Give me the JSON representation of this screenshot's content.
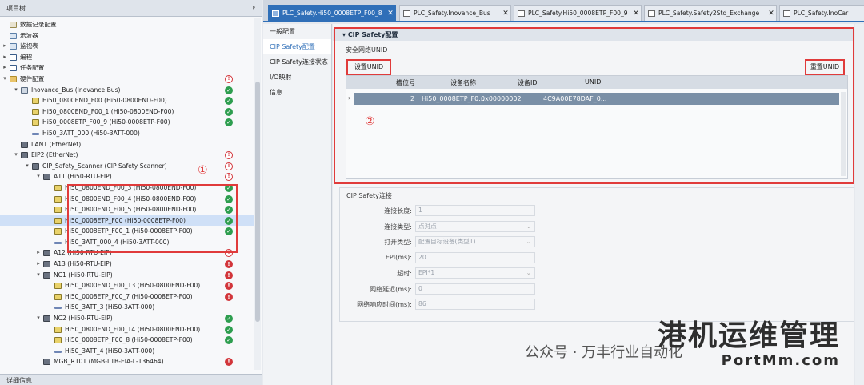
{
  "project_tree": {
    "title": "项目树",
    "pin": "ᵖ",
    "footer": "详细信息",
    "items": [
      {
        "label": "数据记录配置",
        "level": 3,
        "icon": "rec",
        "arrow": "",
        "status": ""
      },
      {
        "label": "示波器",
        "level": 3,
        "icon": "tab",
        "arrow": "",
        "status": ""
      },
      {
        "label": "监视表",
        "level": 3,
        "icon": "tab",
        "arrow": "▸",
        "status": ""
      },
      {
        "label": "编程",
        "level": 3,
        "icon": "doc",
        "arrow": "▸",
        "status": ""
      },
      {
        "label": "任务配置",
        "level": 3,
        "icon": "doc",
        "arrow": "▸",
        "status": ""
      },
      {
        "label": "硬件配置",
        "level": 3,
        "icon": "fold",
        "arrow": "▾",
        "status": "warn"
      },
      {
        "label": "Inovance_Bus (Inovance Bus)",
        "level": 4,
        "icon": "bus",
        "arrow": "▾",
        "status": "ok"
      },
      {
        "label": "Hi50_0800END_F00 (Hi50-0800END-F00)",
        "level": 5,
        "icon": "mod",
        "arrow": "",
        "status": "ok"
      },
      {
        "label": "Hi50_0800END_F00_1 (Hi50-0800END-F00)",
        "level": 5,
        "icon": "mod",
        "arrow": "",
        "status": "ok"
      },
      {
        "label": "Hi50_0008ETP_F00_9 (Hi50-0008ETP-F00)",
        "level": 5,
        "icon": "mod",
        "arrow": "",
        "status": "ok"
      },
      {
        "label": "Hi50_3ATT_000 (Hi50-3ATT-000)",
        "level": 5,
        "icon": "flat",
        "arrow": "",
        "status": ""
      },
      {
        "label": "LAN1 (EtherNet)",
        "level": 4,
        "icon": "dark",
        "arrow": "",
        "status": ""
      },
      {
        "label": "EIP2 (EtherNet)",
        "level": 4,
        "icon": "dark",
        "arrow": "▾",
        "status": "warn"
      },
      {
        "label": "CIP_Safety_Scanner (CIP Safety Scanner)",
        "level": 5,
        "icon": "dark",
        "arrow": "▾",
        "status": "warn"
      },
      {
        "label": "A11 (Hi50-RTU-EIP)",
        "level": 6,
        "icon": "dark",
        "arrow": "▾",
        "status": "warn"
      },
      {
        "label": "Hi50_0800END_F00_3 (Hi50-0800END-F00)",
        "level": 7,
        "icon": "mod",
        "arrow": "",
        "status": "ok"
      },
      {
        "label": "Hi50_0800END_F00_4 (Hi50-0800END-F00)",
        "level": 7,
        "icon": "mod",
        "arrow": "",
        "status": "ok"
      },
      {
        "label": "Hi50_0800END_F00_5 (Hi50-0800END-F00)",
        "level": 7,
        "icon": "mod",
        "arrow": "",
        "status": "ok"
      },
      {
        "label": "Hi50_0008ETP_F00 (Hi50-0008ETP-F00)",
        "level": 7,
        "icon": "mod",
        "arrow": "",
        "status": "ok",
        "selected": true
      },
      {
        "label": "Hi50_0008ETP_F00_1 (Hi50-0008ETP-F00)",
        "level": 7,
        "icon": "mod",
        "arrow": "",
        "status": "ok"
      },
      {
        "label": "Hi50_3ATT_000_4 (Hi50-3ATT-000)",
        "level": 7,
        "icon": "flat",
        "arrow": "",
        "status": ""
      },
      {
        "label": "A12 (Hi50-RTU-EIP)",
        "level": 6,
        "icon": "dark",
        "arrow": "▸",
        "status": "warn"
      },
      {
        "label": "A13 (Hi50-RTU-EIP)",
        "level": 6,
        "icon": "dark",
        "arrow": "▸",
        "status": "err"
      },
      {
        "label": "NC1 (Hi50-RTU-EIP)",
        "level": 6,
        "icon": "dark",
        "arrow": "▾",
        "status": "err"
      },
      {
        "label": "Hi50_0800END_F00_13 (Hi50-0800END-F00)",
        "level": 7,
        "icon": "mod",
        "arrow": "",
        "status": "err"
      },
      {
        "label": "Hi50_0008ETP_F00_7 (Hi50-0008ETP-F00)",
        "level": 7,
        "icon": "mod",
        "arrow": "",
        "status": "err"
      },
      {
        "label": "Hi50_3ATT_3 (Hi50-3ATT-000)",
        "level": 7,
        "icon": "flat",
        "arrow": "",
        "status": ""
      },
      {
        "label": "NC2 (Hi50-RTU-EIP)",
        "level": 6,
        "icon": "dark",
        "arrow": "▾",
        "status": "ok"
      },
      {
        "label": "Hi50_0800END_F00_14 (Hi50-0800END-F00)",
        "level": 7,
        "icon": "mod",
        "arrow": "",
        "status": "ok"
      },
      {
        "label": "Hi50_0008ETP_F00_8 (Hi50-0008ETP-F00)",
        "level": 7,
        "icon": "mod",
        "arrow": "",
        "status": "ok"
      },
      {
        "label": "Hi50_3ATT_4 (Hi50-3ATT-000)",
        "level": 7,
        "icon": "flat",
        "arrow": "",
        "status": ""
      },
      {
        "label": "MGB_R101 (MGB-L1B-EIA-L-136464)",
        "level": 6,
        "icon": "dark",
        "arrow": "",
        "status": "err"
      }
    ]
  },
  "status_glyphs": {
    "ok": "✓",
    "err": "!",
    "warn": "!"
  },
  "status_colors": {
    "ok": "#2e9e4f",
    "err": "#d2353a",
    "warn": "#d2353a"
  },
  "annotations": {
    "circle1": "①",
    "circle2": "②"
  },
  "tabs": [
    {
      "label": "PLC_Safety.Hi50_0008ETP_F00_8",
      "close": "✕",
      "active": true
    },
    {
      "label": "PLC_Safety.Inovance_Bus",
      "close": "✕",
      "active": false
    },
    {
      "label": "PLC_Safety.Hi50_0008ETP_F00_9",
      "close": "✕",
      "active": false
    },
    {
      "label": "PLC_Safety.Safety2Std_Exchange",
      "close": "✕",
      "active": false
    },
    {
      "label": "PLC_Safety.InoCar",
      "close": "",
      "active": false
    }
  ],
  "nav": {
    "items": [
      "一般配置",
      "CIP Safety配置",
      "CIP Safety连接状态",
      "I/O映射",
      "信息"
    ],
    "active_index": 1
  },
  "cip": {
    "section_title": "CIP Safety配置",
    "network_unid_label": "安全网络UNID",
    "set_unid": "设置UNID",
    "reset_unid": "重置UNID",
    "columns": [
      "槽位号",
      "设备名称",
      "设备ID",
      "UNID"
    ],
    "row": {
      "slot": "2",
      "name": "Hi50_0008ETP_F0...",
      "id": "0x00000002",
      "unid": "4C9A00E78DAF_0..."
    }
  },
  "connection": {
    "section_title": "CIP Safety连接",
    "fields": [
      {
        "label": "连接长度:",
        "value": "1",
        "dropdown": ""
      },
      {
        "label": "连接类型:",
        "value": "点对点",
        "dropdown": "⌄"
      },
      {
        "label": "打开类型:",
        "value": "配置目标设备(类型1)",
        "dropdown": "⌄"
      },
      {
        "label": "EPI(ms):",
        "value": "20",
        "dropdown": ""
      },
      {
        "label": "超时:",
        "value": "EPI*1",
        "dropdown": "⌄"
      },
      {
        "label": "网络延迟(ms):",
        "value": "0",
        "dropdown": ""
      },
      {
        "label": "网络响应时间(ms):",
        "value": "86",
        "dropdown": ""
      }
    ]
  },
  "watermark": {
    "title": "港机运维管理",
    "url": "PortMm.com",
    "wechat": "公众号 · 万丰行业自动化"
  }
}
